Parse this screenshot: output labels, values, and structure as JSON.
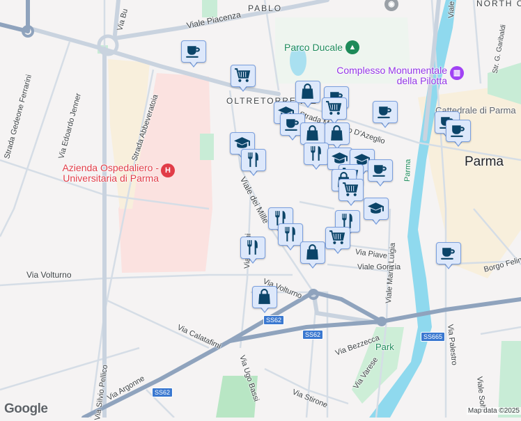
{
  "map": {
    "district_labels": [
      "PABLO",
      "OLTRETORRENTE",
      "NORTH C"
    ],
    "city_label": "Parma",
    "street_labels": {
      "viale_piacenza": "Viale Piacenza",
      "via_buffolara": "Via Bu",
      "strada_ferrarini": "Strada Gedeone Ferrarini",
      "via_jenner": "Via Edoardo Jenner",
      "strada_abbeveratoia": "Strada Abbeveratoia",
      "viale_milazzo": "Viale dei Mille",
      "via_musini": "Via Musini",
      "strada_azeglio": "Strada Massimo D'Azeglio",
      "via_volturno_w": "Via Volturno",
      "via_volturno_e": "Via Volturno",
      "via_piave": "Via Piave",
      "viale_gorizia": "Viale Gorizia",
      "viale_maria_luigia": "Viale Maria Luigia",
      "borgo_felino": "Borgo Felino",
      "via_calatafimi": "Via Calatafimi",
      "via_ugo_bassi": "Via Ugo Bassi",
      "via_bezzecca": "Via Bezzecca",
      "via_varese": "Via Varese",
      "via_stirone": "Via Stirone",
      "via_argonne": "Via Argonne",
      "via_silvio_pellico": "Via Silvio Pellico",
      "via_palestro": "Via Palestro",
      "viale_solferino": "Viale Solfe",
      "str_garibaldi": "Str. G. Garibaldi",
      "viale_top": "Viale",
      "river_parma": "Parma",
      "cattedrale": "Cattedrale di Parma"
    },
    "road_shields": [
      "SS62",
      "SS62",
      "SS62",
      "SS665"
    ],
    "pois": {
      "hospital": "Azienda Ospedaliero - Universitaria di Parma",
      "park": "Parco Ducale",
      "museum": "Complesso Monumentale della Pilotta",
      "park_small": "Park"
    },
    "markers": [
      "cafe",
      "cart",
      "cap",
      "restaurant",
      "bag",
      "cafe",
      "cap",
      "cart",
      "cafe",
      "bag",
      "bag",
      "restaurant",
      "cafe",
      "cafe",
      "cafe",
      "cap",
      "cap",
      "cafe",
      "cart",
      "bag",
      "cap",
      "restaurant",
      "restaurant",
      "restaurant",
      "restaurant",
      "cart",
      "bag",
      "cart",
      "bag",
      "cafe"
    ],
    "branding": "Google",
    "attribution": "Map data ©2025"
  },
  "colors": {
    "marker_icon": "#0b4468",
    "marker_fill": "#dde8fb",
    "highway": "#8fa3bd",
    "river": "#8fd9ee"
  }
}
